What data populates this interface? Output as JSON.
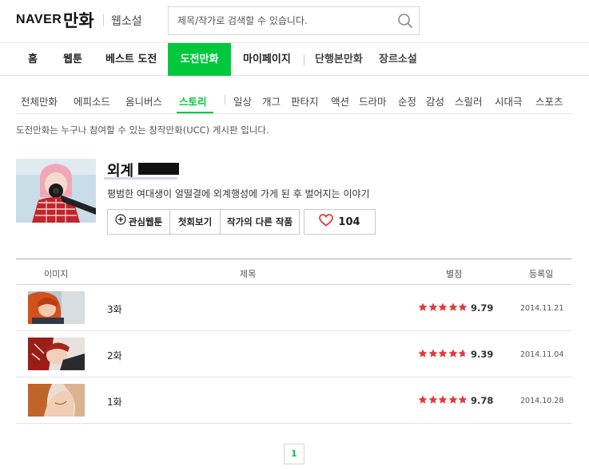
{
  "header": {
    "logo_naver": "NAVER",
    "logo_manhwa": "만화",
    "webnovel": "웹소설",
    "search_placeholder": "제목/작가로 검색할 수 있습니다."
  },
  "nav": {
    "items": [
      "홈",
      "웹툰",
      "베스트 도전",
      "도전만화",
      "마이페이지",
      "단행본만화",
      "장르소설"
    ],
    "active": "도전만화"
  },
  "subnav": {
    "items": [
      "전체만화",
      "에피소드",
      "옴니버스",
      "스토리",
      "일상",
      "개그",
      "판타지",
      "액션",
      "드라마",
      "순정",
      "감성",
      "스릴러",
      "시대극",
      "스포츠"
    ],
    "active": "스토리"
  },
  "notice": "도전만화는 누구나 참여할 수 있는 창작만화(UCC) 게시판 입니다.",
  "comic": {
    "title": "외계",
    "description": "평범한 여대생이 얼떨결에 외계행성에 가게 된 후 벌어지는 이야기",
    "buttons": {
      "favorite": "관심웹툰",
      "first": "첫회보기",
      "other_works": "작가의 다른 작품"
    },
    "likes": "104"
  },
  "table": {
    "headers": [
      "이미지",
      "제목",
      "별점",
      "등록일"
    ],
    "rows": [
      {
        "title": "3화",
        "rating": 9.79,
        "score": "9.79",
        "date": "2014.11.21"
      },
      {
        "title": "2화",
        "rating": 9.39,
        "score": "9.39",
        "date": "2014.11.04"
      },
      {
        "title": "1화",
        "rating": 9.78,
        "score": "9.78",
        "date": "2014.10.28"
      }
    ]
  },
  "pagination": {
    "current": "1"
  },
  "colors": {
    "accent": "#00c73c",
    "star": "#e4393c",
    "heart": "#e4393c"
  }
}
